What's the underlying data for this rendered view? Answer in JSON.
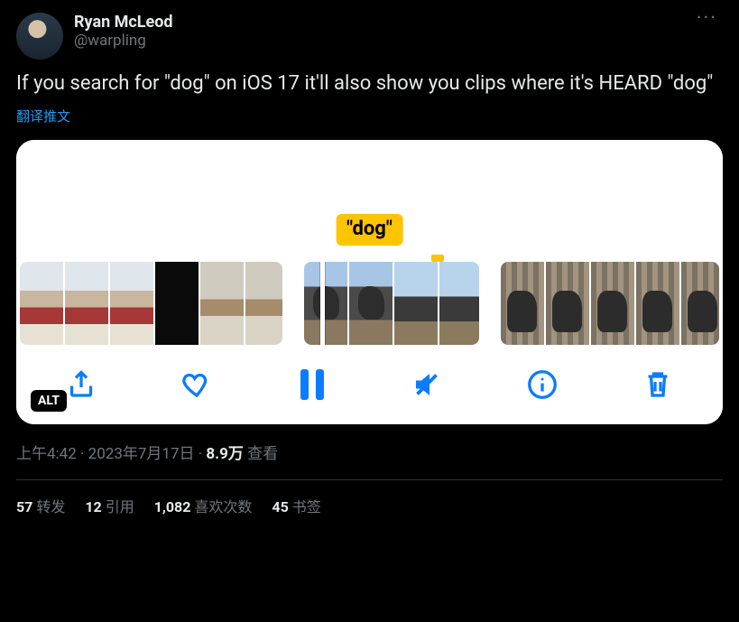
{
  "author": {
    "display_name": "Ryan McLeod",
    "handle": "@warpling"
  },
  "content_text": "If you search for \"dog\" on iOS 17 it'll also show you clips where it's HEARD \"dog\"",
  "translate_label": "翻译推文",
  "media": {
    "search_badge": "\"dog\"",
    "alt_label": "ALT",
    "icons": {
      "share": "share-icon",
      "like": "heart-icon",
      "pause": "pause-icon",
      "mute": "mute-icon",
      "info": "info-icon",
      "trash": "trash-icon"
    }
  },
  "meta": {
    "time": "上午4:42",
    "date": "2023年7月17日",
    "views_count": "8.9万",
    "views_label": "查看",
    "separator": " · "
  },
  "stats": {
    "retweets": {
      "count": "57",
      "label": "转发"
    },
    "quotes": {
      "count": "12",
      "label": "引用"
    },
    "likes": {
      "count": "1,082",
      "label": "喜欢次数"
    },
    "bookmarks": {
      "count": "45",
      "label": "书签"
    }
  }
}
